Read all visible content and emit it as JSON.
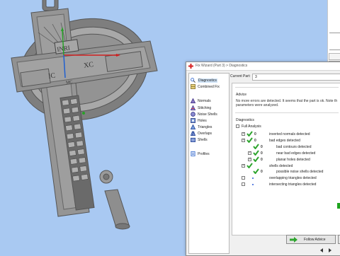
{
  "viewport": {
    "model_labels": [
      "INRI",
      "IC",
      "XC",
      "MC"
    ],
    "colors": {
      "background": "#a9c9f2",
      "model": "#8a8a8a",
      "axis_x": "#d02020",
      "axis_y": "#28a028",
      "axis_z": "#2060d0"
    }
  },
  "wizard": {
    "title": "Fix Wizard (Part 3) > Diagnostics",
    "nav_items": [
      {
        "label": "Diagnostics",
        "icon": "magnifier-icon",
        "selected": true
      },
      {
        "label": "Combined Fix",
        "icon": "combined-fix-icon",
        "selected": false
      },
      {
        "label": "Normals",
        "icon": "normals-icon",
        "selected": false
      },
      {
        "label": "Stitching",
        "icon": "stitching-icon",
        "selected": false
      },
      {
        "label": "Noise Shells",
        "icon": "noise-shells-icon",
        "selected": false
      },
      {
        "label": "Holes",
        "icon": "holes-icon",
        "selected": false
      },
      {
        "label": "Triangles",
        "icon": "triangles-icon",
        "selected": false
      },
      {
        "label": "Overlaps",
        "icon": "overlaps-icon",
        "selected": false
      },
      {
        "label": "Shells",
        "icon": "shells-icon",
        "selected": false
      },
      {
        "label": "Profiles",
        "icon": "profiles-icon",
        "selected": false
      }
    ],
    "current_part_label": "Current Part:",
    "current_part_value": "3",
    "advice_title": "Advice",
    "advice_line1": "No more errors are detected. It seems that the part is ok. Note th",
    "advice_line2": "parameters were analyzed.",
    "diagnostics_title": "Diagnostics",
    "full_analysis_label": "Full Analysis",
    "full_analysis_checked": false,
    "rows": [
      {
        "checked": true,
        "status": "ok",
        "count": "0",
        "label": "inverted normals detected",
        "indent": 0
      },
      {
        "checked": true,
        "status": "ok",
        "count": "0",
        "label": "bad edges detected",
        "indent": 0
      },
      {
        "checked": null,
        "status": "ok",
        "count": "0",
        "label": "bad contours detected",
        "indent": 1
      },
      {
        "checked": true,
        "status": "ok",
        "count": "0",
        "label": "near bad edges detected",
        "indent": 1
      },
      {
        "checked": true,
        "status": "ok",
        "count": "0",
        "label": "planar holes detected",
        "indent": 1
      },
      {
        "checked": true,
        "status": "ok",
        "count": "",
        "label": "shells detected",
        "indent": 0
      },
      {
        "checked": null,
        "status": "ok",
        "count": "0",
        "label": "possible noise shells detected",
        "indent": 1
      },
      {
        "checked": false,
        "status": "none",
        "count": "",
        "label": "overlapping triangles detected",
        "indent": 0
      },
      {
        "checked": false,
        "status": "none",
        "count": "",
        "label": "intersecting triangles detected",
        "indent": 0
      }
    ],
    "follow_advice_label": "Follow Advice",
    "accent_green": "#2ea52e",
    "accent_blue": "#2a5bd7"
  }
}
